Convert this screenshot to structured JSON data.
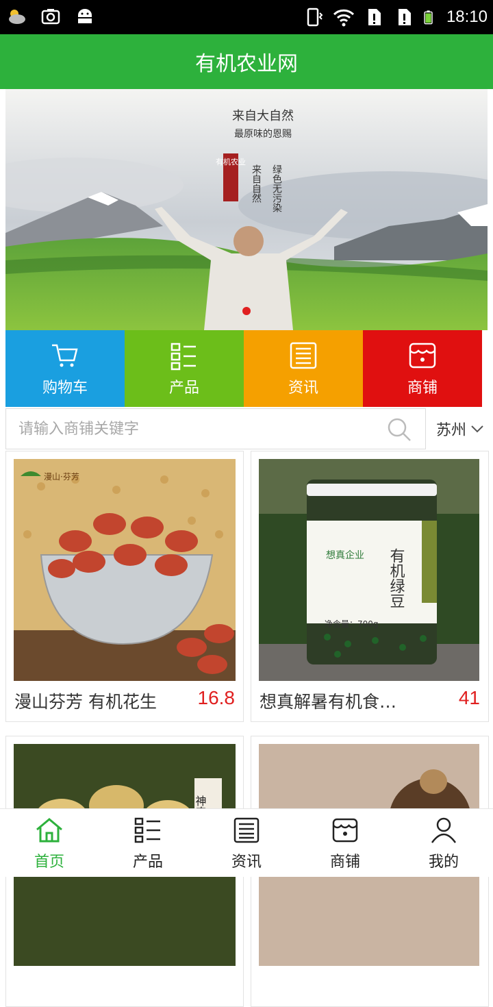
{
  "status_bar": {
    "time": "18:10",
    "left_icons": [
      "weather-icon",
      "screenshot-icon",
      "android-icon"
    ],
    "right_icons": [
      "vibrate-icon",
      "wifi-icon",
      "sim1-icon",
      "sim2-icon",
      "battery-icon"
    ]
  },
  "app_bar": {
    "title": "有机农业网"
  },
  "banner": {
    "headline": "来自大自然",
    "subheadline": "最原味的恩赐",
    "seal": "有机农业",
    "col1": "来自自然",
    "col2": "绿色无污染",
    "active_slide": 1
  },
  "quick_links": [
    {
      "label": "购物车",
      "icon": "cart-icon",
      "color": "#1a9fe0"
    },
    {
      "label": "产品",
      "icon": "product-grid-icon",
      "color": "#6cbe1a"
    },
    {
      "label": "资讯",
      "icon": "news-icon",
      "color": "#f5a000"
    },
    {
      "label": "商铺",
      "icon": "shop-icon",
      "color": "#e01010"
    }
  ],
  "search": {
    "placeholder": "请输入商铺关键字",
    "value": ""
  },
  "city": {
    "selected": "苏州"
  },
  "products": [
    {
      "name": "漫山芬芳 有机花生",
      "price": "16.8",
      "brand_text": "漫山·芬芳"
    },
    {
      "name": "想真解暑有机食品绿豆",
      "price": "41",
      "brand_text": "想真企业",
      "jar_text": "有机绿豆",
      "weight": "净含量：700g"
    },
    {
      "name": "",
      "price": "",
      "tag_text": "神农"
    },
    {
      "name": "",
      "price": ""
    }
  ],
  "bottom_nav": [
    {
      "label": "首页",
      "icon": "home-icon",
      "active": true
    },
    {
      "label": "产品",
      "icon": "product-grid-icon",
      "active": false
    },
    {
      "label": "资讯",
      "icon": "news-icon",
      "active": false
    },
    {
      "label": "商铺",
      "icon": "shop-icon",
      "active": false
    },
    {
      "label": "我的",
      "icon": "user-icon",
      "active": false
    }
  ],
  "colors": {
    "brand_green": "#2db13c",
    "price_red": "#e02020"
  }
}
